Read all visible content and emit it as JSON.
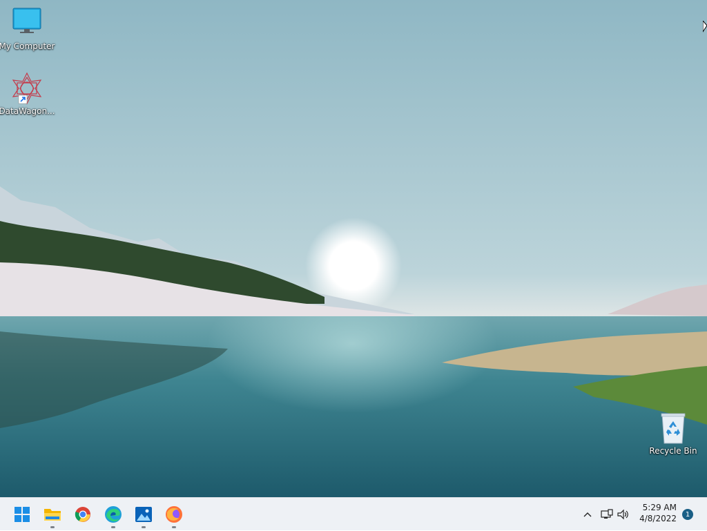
{
  "desktop": {
    "icons": [
      {
        "label": "My Computer",
        "icon": "monitor-icon"
      },
      {
        "label": "DataWagon...",
        "icon": "datawagon-logo-icon",
        "shortcut": true
      },
      {
        "label": "Recycle Bin",
        "icon": "recycle-bin-icon"
      }
    ]
  },
  "taskbar": {
    "apps": [
      {
        "name": "Start",
        "icon": "windows-start-icon",
        "running": false
      },
      {
        "name": "File Explorer",
        "icon": "folder-icon",
        "running": true
      },
      {
        "name": "Google Chrome",
        "icon": "chrome-icon",
        "running": false
      },
      {
        "name": "Microsoft Edge",
        "icon": "edge-icon",
        "running": true
      },
      {
        "name": "Photos",
        "icon": "photos-icon",
        "running": true
      },
      {
        "name": "Firefox",
        "icon": "firefox-icon",
        "running": true
      }
    ],
    "tray": {
      "clock_time": "5:29 AM",
      "clock_date": "4/8/2022",
      "notification_count": "1"
    }
  },
  "colors": {
    "taskbar_bg": "#eef1f5",
    "accent": "#0078d4"
  }
}
